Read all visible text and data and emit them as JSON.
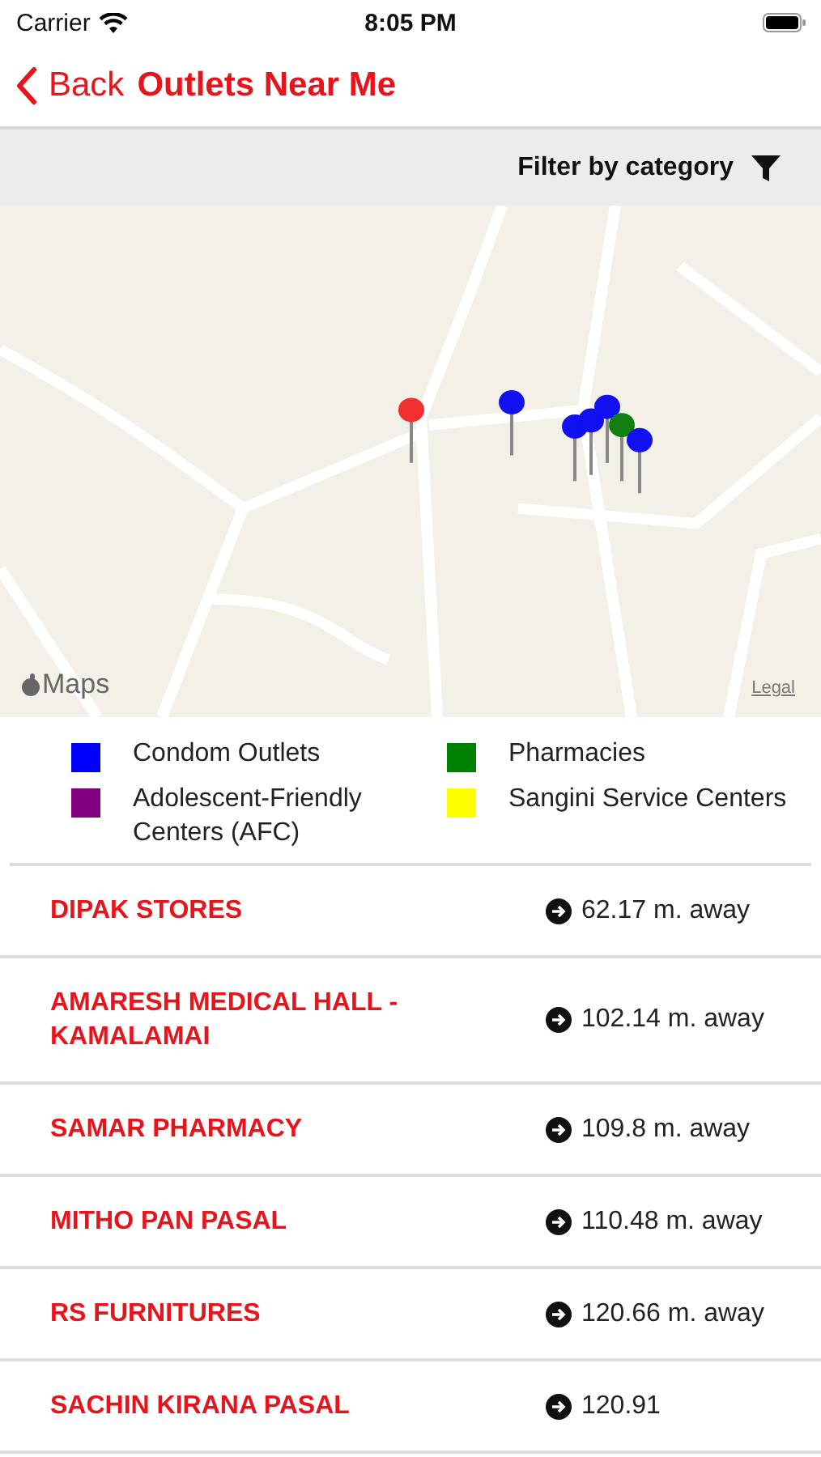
{
  "status_bar": {
    "carrier": "Carrier",
    "time": "8:05 PM"
  },
  "nav": {
    "back": "Back",
    "title": "Outlets Near Me"
  },
  "filter": {
    "label": "Filter by category"
  },
  "map": {
    "kind": "picture",
    "brand": "Maps",
    "legal": "Legal"
  },
  "legend": [
    {
      "label": "Condom Outlets",
      "color": "#0000ff"
    },
    {
      "label": "Pharmacies",
      "color": "#008000"
    },
    {
      "label": "Adolescent-Friendly Centers (AFC)",
      "color": "#800080"
    },
    {
      "label": "Sangini Service Centers",
      "color": "#ffff00"
    }
  ],
  "outlets": [
    {
      "name": "DIPAK STORES",
      "distance": "62.17 m. away"
    },
    {
      "name": "AMARESH MEDICAL HALL - KAMALAMAI",
      "distance": "102.14 m. away"
    },
    {
      "name": "SAMAR PHARMACY",
      "distance": "109.8 m. away"
    },
    {
      "name": "MITHO PAN PASAL",
      "distance": "110.48 m. away"
    },
    {
      "name": "RS FURNITURES",
      "distance": "120.66 m. away"
    },
    {
      "name": "SACHIN KIRANA PASAL",
      "distance": "120.91"
    }
  ]
}
